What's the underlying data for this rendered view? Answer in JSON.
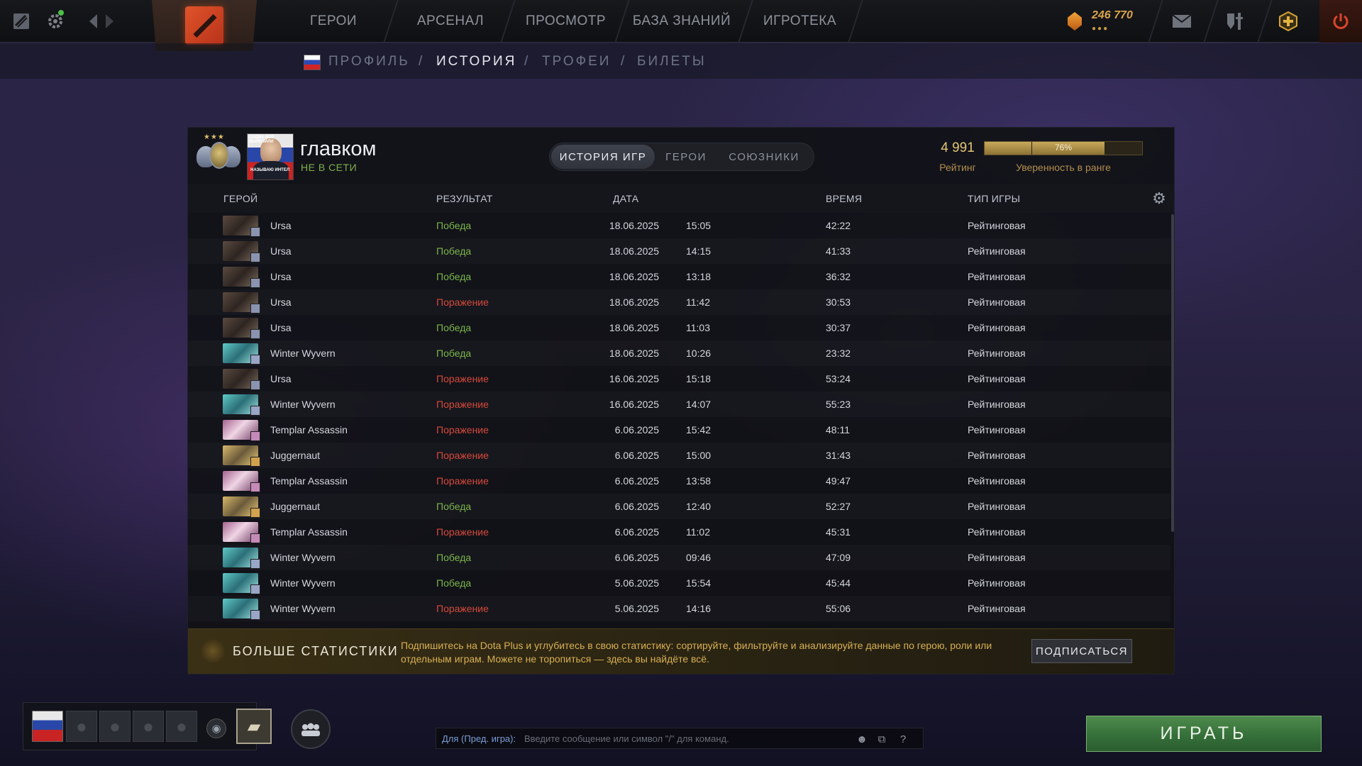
{
  "topbar": {
    "nav": [
      "ГЕРОИ",
      "АРСЕНАЛ",
      "ПРОСМОТР",
      "БАЗА ЗНАНИЙ",
      "ИГРОТЕКА"
    ],
    "currency": "246 770",
    "icons": {
      "dota_plus": "dota-plus-icon",
      "settings": "gear-icon",
      "back": "arrow-left-icon",
      "forward": "arrow-right-icon",
      "logo": "dota-logo",
      "mail": "mail-icon",
      "armory": "armory-icon",
      "plus_assistant": "plus-icon",
      "power": "power-icon"
    }
  },
  "subnav": {
    "items": [
      "ПРОФИЛЬ",
      "ИСТОРИЯ",
      "ТРОФЕИ",
      "БИЛЕТЫ"
    ],
    "active_index": 1
  },
  "profile": {
    "name": "главком",
    "status": "НЕ В СЕТИ",
    "avatar_caption_top": "СЛОВА ВСЕ ВЫРАЗИЛИ",
    "avatar_caption_bottom": "НАЗЫВАЮ ИНТЕЛ"
  },
  "tabs": [
    "ИСТОРИЯ ИГР",
    "ГЕРОИ",
    "СОЮЗНИКИ"
  ],
  "rating": {
    "value": "4 991",
    "label": "Рейтинг",
    "confidence_text": "76%",
    "confidence": 0.76,
    "confidence_label": "Уверенность в ранге"
  },
  "table": {
    "headers": {
      "hero": "ГЕРОЙ",
      "result": "РЕЗУЛЬТАТ",
      "date": "ДАТА",
      "time": "ВРЕМЯ",
      "type": "ТИП ИГРЫ"
    },
    "rows": [
      {
        "hero": "Ursa",
        "hero_key": "ursa",
        "result": "Победа",
        "win": true,
        "date": "18.06.2025",
        "clock": "15:05",
        "duration": "42:22",
        "type": "Рейтинговая"
      },
      {
        "hero": "Ursa",
        "hero_key": "ursa",
        "result": "Победа",
        "win": true,
        "date": "18.06.2025",
        "clock": "14:15",
        "duration": "41:33",
        "type": "Рейтинговая"
      },
      {
        "hero": "Ursa",
        "hero_key": "ursa",
        "result": "Победа",
        "win": true,
        "date": "18.06.2025",
        "clock": "13:18",
        "duration": "36:32",
        "type": "Рейтинговая"
      },
      {
        "hero": "Ursa",
        "hero_key": "ursa",
        "result": "Поражение",
        "win": false,
        "date": "18.06.2025",
        "clock": "11:42",
        "duration": "30:53",
        "type": "Рейтинговая"
      },
      {
        "hero": "Ursa",
        "hero_key": "ursa",
        "result": "Победа",
        "win": true,
        "date": "18.06.2025",
        "clock": "11:03",
        "duration": "30:37",
        "type": "Рейтинговая"
      },
      {
        "hero": "Winter Wyvern",
        "hero_key": "wyvern",
        "result": "Победа",
        "win": true,
        "date": "18.06.2025",
        "clock": "10:26",
        "duration": "23:32",
        "type": "Рейтинговая"
      },
      {
        "hero": "Ursa",
        "hero_key": "ursa",
        "result": "Поражение",
        "win": false,
        "date": "16.06.2025",
        "clock": "15:18",
        "duration": "53:24",
        "type": "Рейтинговая"
      },
      {
        "hero": "Winter Wyvern",
        "hero_key": "wyvern",
        "result": "Поражение",
        "win": false,
        "date": "16.06.2025",
        "clock": "14:07",
        "duration": "55:23",
        "type": "Рейтинговая"
      },
      {
        "hero": "Templar Assassin",
        "hero_key": "templar",
        "result": "Поражение",
        "win": false,
        "date": "6.06.2025",
        "clock": "15:42",
        "duration": "48:11",
        "type": "Рейтинговая"
      },
      {
        "hero": "Juggernaut",
        "hero_key": "jugg",
        "result": "Поражение",
        "win": false,
        "date": "6.06.2025",
        "clock": "15:00",
        "duration": "31:43",
        "type": "Рейтинговая"
      },
      {
        "hero": "Templar Assassin",
        "hero_key": "templar",
        "result": "Поражение",
        "win": false,
        "date": "6.06.2025",
        "clock": "13:58",
        "duration": "49:47",
        "type": "Рейтинговая"
      },
      {
        "hero": "Juggernaut",
        "hero_key": "jugg",
        "result": "Победа",
        "win": true,
        "date": "6.06.2025",
        "clock": "12:40",
        "duration": "52:27",
        "type": "Рейтинговая"
      },
      {
        "hero": "Templar Assassin",
        "hero_key": "templar",
        "result": "Поражение",
        "win": false,
        "date": "6.06.2025",
        "clock": "11:02",
        "duration": "45:31",
        "type": "Рейтинговая"
      },
      {
        "hero": "Winter Wyvern",
        "hero_key": "wyvern",
        "result": "Победа",
        "win": true,
        "date": "6.06.2025",
        "clock": "09:46",
        "duration": "47:09",
        "type": "Рейтинговая"
      },
      {
        "hero": "Winter Wyvern",
        "hero_key": "wyvern",
        "result": "Победа",
        "win": true,
        "date": "5.06.2025",
        "clock": "15:54",
        "duration": "45:44",
        "type": "Рейтинговая"
      },
      {
        "hero": "Winter Wyvern",
        "hero_key": "wyvern",
        "result": "Поражение",
        "win": false,
        "date": "5.06.2025",
        "clock": "14:16",
        "duration": "55:06",
        "type": "Рейтинговая"
      }
    ]
  },
  "promo": {
    "title": "БОЛЬШЕ СТАТИСТИКИ",
    "text": "Подпишитесь на Dota Plus и углубитесь в свою статистику: сортируйте, фильтруйте и анализируйте данные по герою, роли или отдельным играм. Можете не торопиться — здесь вы найдёте всё.",
    "button": "ПОДПИСАТЬСЯ"
  },
  "chat": {
    "target": "Для (Пред. игра):",
    "placeholder": "Введите сообщение или символ \"/\" для команд."
  },
  "play_button": "ИГРАТЬ",
  "colors": {
    "win": "#7ab648",
    "loss": "#d64a3a",
    "gold": "#d8b054",
    "play": "#36703a"
  }
}
